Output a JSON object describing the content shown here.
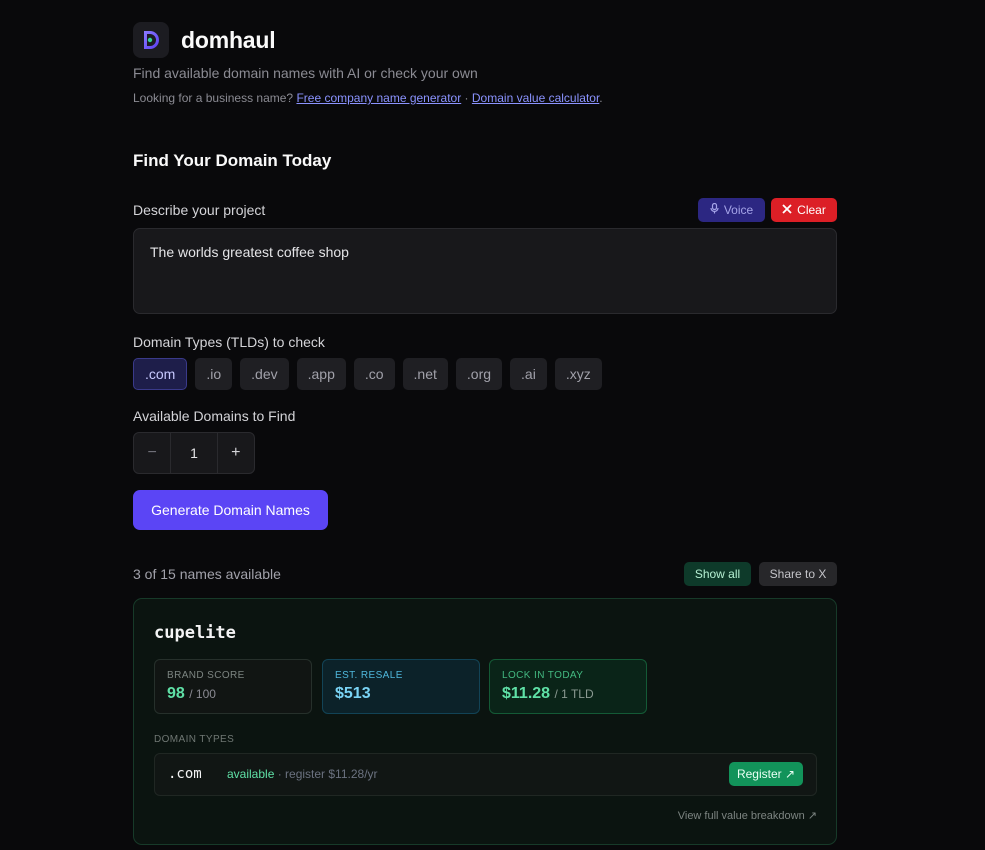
{
  "app": {
    "name": "domhaul",
    "tagline": "Find available domain names with AI or check your own",
    "links_prefix": "Looking for a business name?",
    "link1": "Free company name generator",
    "link_sep": " · ",
    "link2": "Domain value calculator",
    "links_suffix": "."
  },
  "form": {
    "title": "Find Your Domain Today",
    "describe_label": "Describe your project",
    "voice_label": "Voice",
    "clear_label": "Clear",
    "project_text": "The worlds greatest coffee shop",
    "tld_label": "Domain Types (TLDs) to check",
    "tlds": [
      ".com",
      ".io",
      ".dev",
      ".app",
      ".co",
      ".net",
      ".org",
      ".ai",
      ".xyz"
    ],
    "selected_tld": ".com",
    "count_label": "Available Domains to Find",
    "count_value": "1",
    "minus": "−",
    "plus": "+",
    "generate_label": "Generate Domain Names"
  },
  "results": {
    "summary": "3 of 15 names available",
    "show_all_label": "Show all",
    "share_label": "Share to X",
    "card": {
      "name": "cupelite",
      "brand_score_title": "BRAND SCORE",
      "brand_score": "98",
      "brand_score_max": "/ 100",
      "resale_title": "EST. RESALE",
      "resale": "$513",
      "lock_title": "LOCK IN TODAY",
      "lock_price": "$11.28",
      "lock_unit": "/ 1 TLD",
      "domain_types_label": "DOMAIN TYPES",
      "domain_ext": ".com",
      "status": "available",
      "status_detail": " · register $11.28/yr",
      "register_label": "Register ↗",
      "breakdown_label": "View full value breakdown ↗"
    }
  },
  "colors": {
    "accent": "#5b45f5",
    "success": "#5fe0a6",
    "danger": "#dc1f26",
    "background": "#09090b"
  },
  "icons": {
    "logo": "domhaul-logo-icon",
    "voice": "microphone-icon",
    "clear": "close-icon"
  }
}
